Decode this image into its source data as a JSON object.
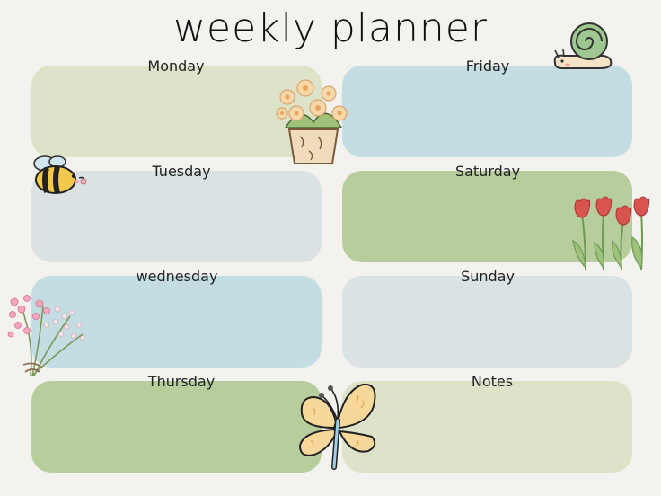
{
  "title": "weekly planner",
  "days": {
    "monday": "Monday",
    "tuesday": "Tuesday",
    "wednesday": "wednesday",
    "thursday": "Thursday",
    "friday": "Friday",
    "saturday": "Saturday",
    "sunday": "Sunday",
    "notes": "Notes"
  },
  "colors": {
    "sage_light": "#dde3c8",
    "sky_blue": "#c3dde3",
    "gray_blue": "#dae2e4",
    "sage_green": "#b7cd9c",
    "background": "#f3f2ef"
  },
  "decorations": [
    "snail-sticker",
    "flower-basket-sticker",
    "bee-sticker",
    "tulips-sticker",
    "pink-flower-bouquet-sticker",
    "butterfly-sticker"
  ]
}
